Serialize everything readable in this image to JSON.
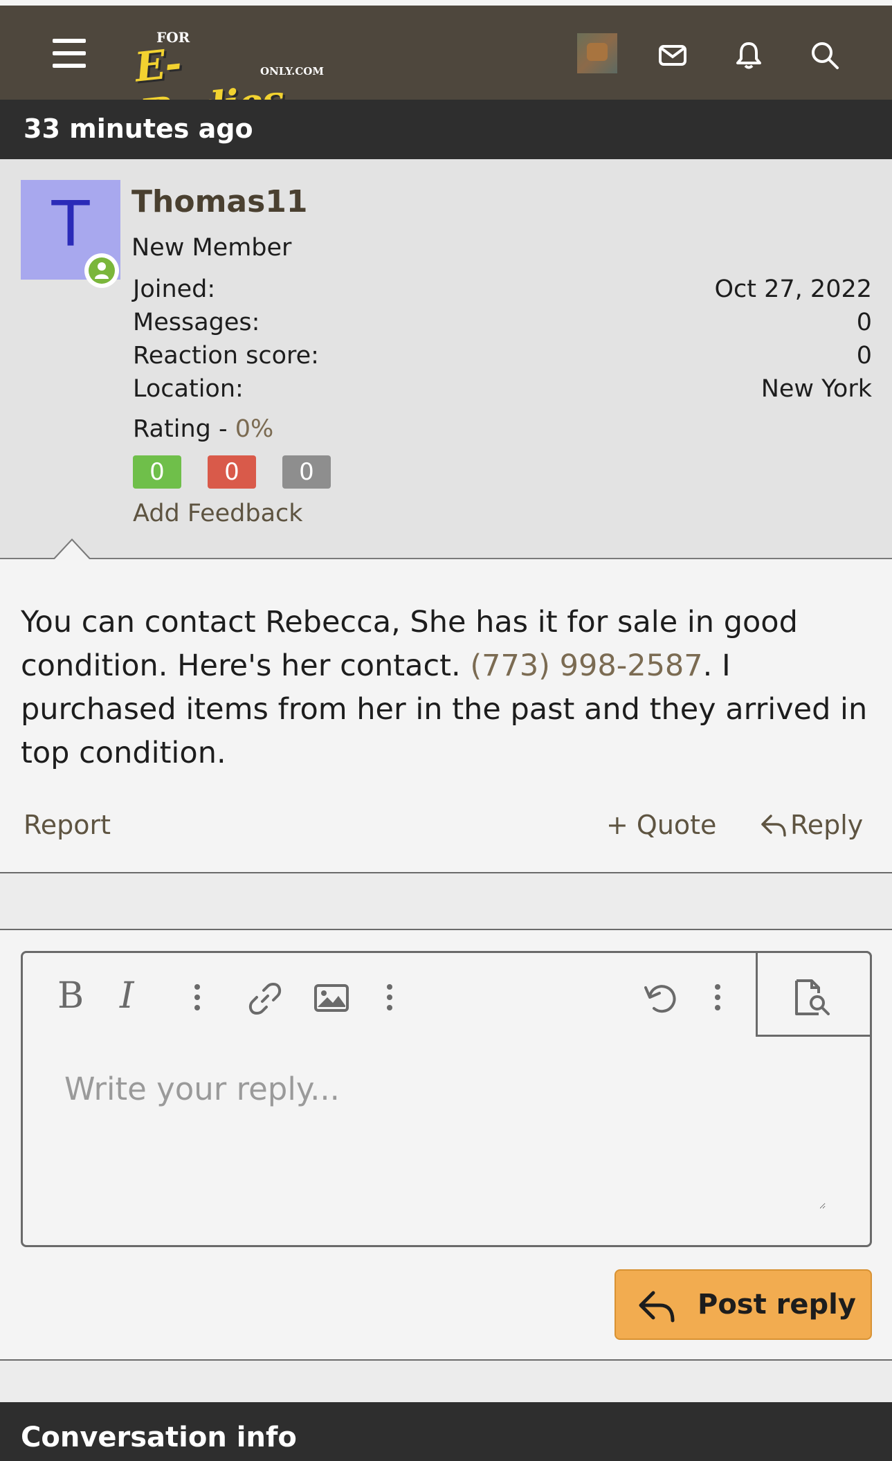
{
  "header": {
    "logo": {
      "for_text": "FOR",
      "brand_text": "E-Bodies",
      "only_text": "ONLY.COM"
    },
    "icons": [
      "menu-icon",
      "envelope-icon",
      "bell-icon",
      "search-icon"
    ]
  },
  "conversation": {
    "timestamp": "33 minutes ago"
  },
  "user": {
    "avatar_letter": "T",
    "avatar_color": "#a8a8ee",
    "name": "Thomas11",
    "title": "New Member",
    "stats": [
      {
        "label": "Joined:",
        "value": "Oct 27, 2022"
      },
      {
        "label": "Messages:",
        "value": "0"
      },
      {
        "label": "Reaction score:",
        "value": "0"
      },
      {
        "label": "Location:",
        "value": "New York"
      }
    ],
    "rating_label": "Rating - ",
    "rating_value": "0%",
    "feedback": {
      "positive": "0",
      "negative": "0",
      "neutral": "0"
    },
    "add_feedback": "Add Feedback"
  },
  "message": {
    "text_before": "You can contact Rebecca, She has it for sale in good condition. Here's her contact. ",
    "phone": "(773) 998-2587",
    "text_after": ". I purchased items from her in the past and they arrived in top condition."
  },
  "actions": {
    "report": "Report",
    "quote": "+ Quote",
    "reply": "Reply"
  },
  "editor": {
    "bold": "B",
    "italic": "I",
    "placeholder": "Write your reply...",
    "value": ""
  },
  "post_reply": "Post reply",
  "conversation_info": "Conversation info",
  "colors": {
    "header_bg": "#4e473d",
    "dark_bar": "#2e2e2e",
    "accent_button": "#f2ac50",
    "link": "#7b6b52",
    "online": "#7ab63b",
    "feedback_positive": "#6fbf4a",
    "feedback_negative": "#d95a4a",
    "feedback_neutral": "#8e8e8e"
  }
}
